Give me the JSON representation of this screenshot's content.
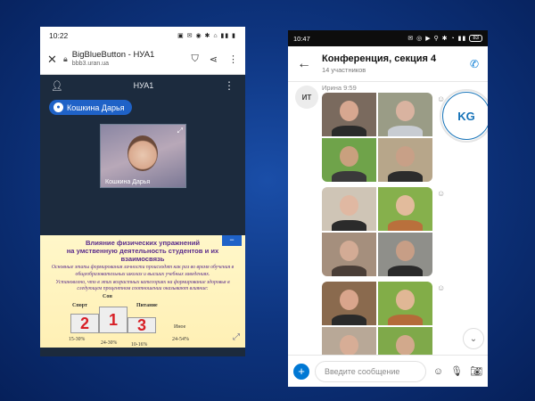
{
  "left_phone": {
    "status_time": "10:22",
    "status_icons": "▣ ✉ ◉ ✱ ⌂ ▮▮ ▮",
    "browser": {
      "close_icon": "close-icon",
      "title": "BigBlueButton - НУА1",
      "url": "bbb3.uran.ua"
    },
    "meeting": {
      "name": "НУА1",
      "speaker": "Кошкина Дарья",
      "webcam_label": "Кошкина Дарья"
    },
    "slide": {
      "title_line1": "Влияние физических упражнений",
      "title_line2": "на умственную деятельность студентов и их взаимосвязь",
      "para1": "Основные этапы формирования личности происходят как раз во время обучения в общеобразовательных школах и высших учебных заведениях.",
      "para2": "Установлено, что в этих возрастных категориях на формирование здоровья в следующем процентном соотношении оказывают влияние:",
      "podium": [
        {
          "rank": "2",
          "label": "Спорт",
          "pct": "15-30%"
        },
        {
          "rank": "1",
          "label": "Сон",
          "pct": "24-30%"
        },
        {
          "rank": "3",
          "label": "Питание",
          "pct": "10-16%"
        }
      ],
      "other_label": "Иное",
      "other_pct": "24-54%"
    }
  },
  "right_phone": {
    "status_time": "10:47",
    "status_icons": "✉ ◎ ▶ ⚲ ✱ ◔ ▮▮",
    "battery": "83",
    "header": {
      "title": "Конференция, секция 4",
      "subtitle": "14 участников"
    },
    "message": {
      "avatar": "ИТ",
      "sender": "Ирина 9:59"
    },
    "participant_avatar": "KG",
    "composer_placeholder": "Введите сообщение"
  },
  "colors": {
    "bbb_blue": "#1f62c7",
    "skype_blue": "#0078d4",
    "slide_text": "#5b2d8c",
    "podium_rank": "#d81f26"
  }
}
